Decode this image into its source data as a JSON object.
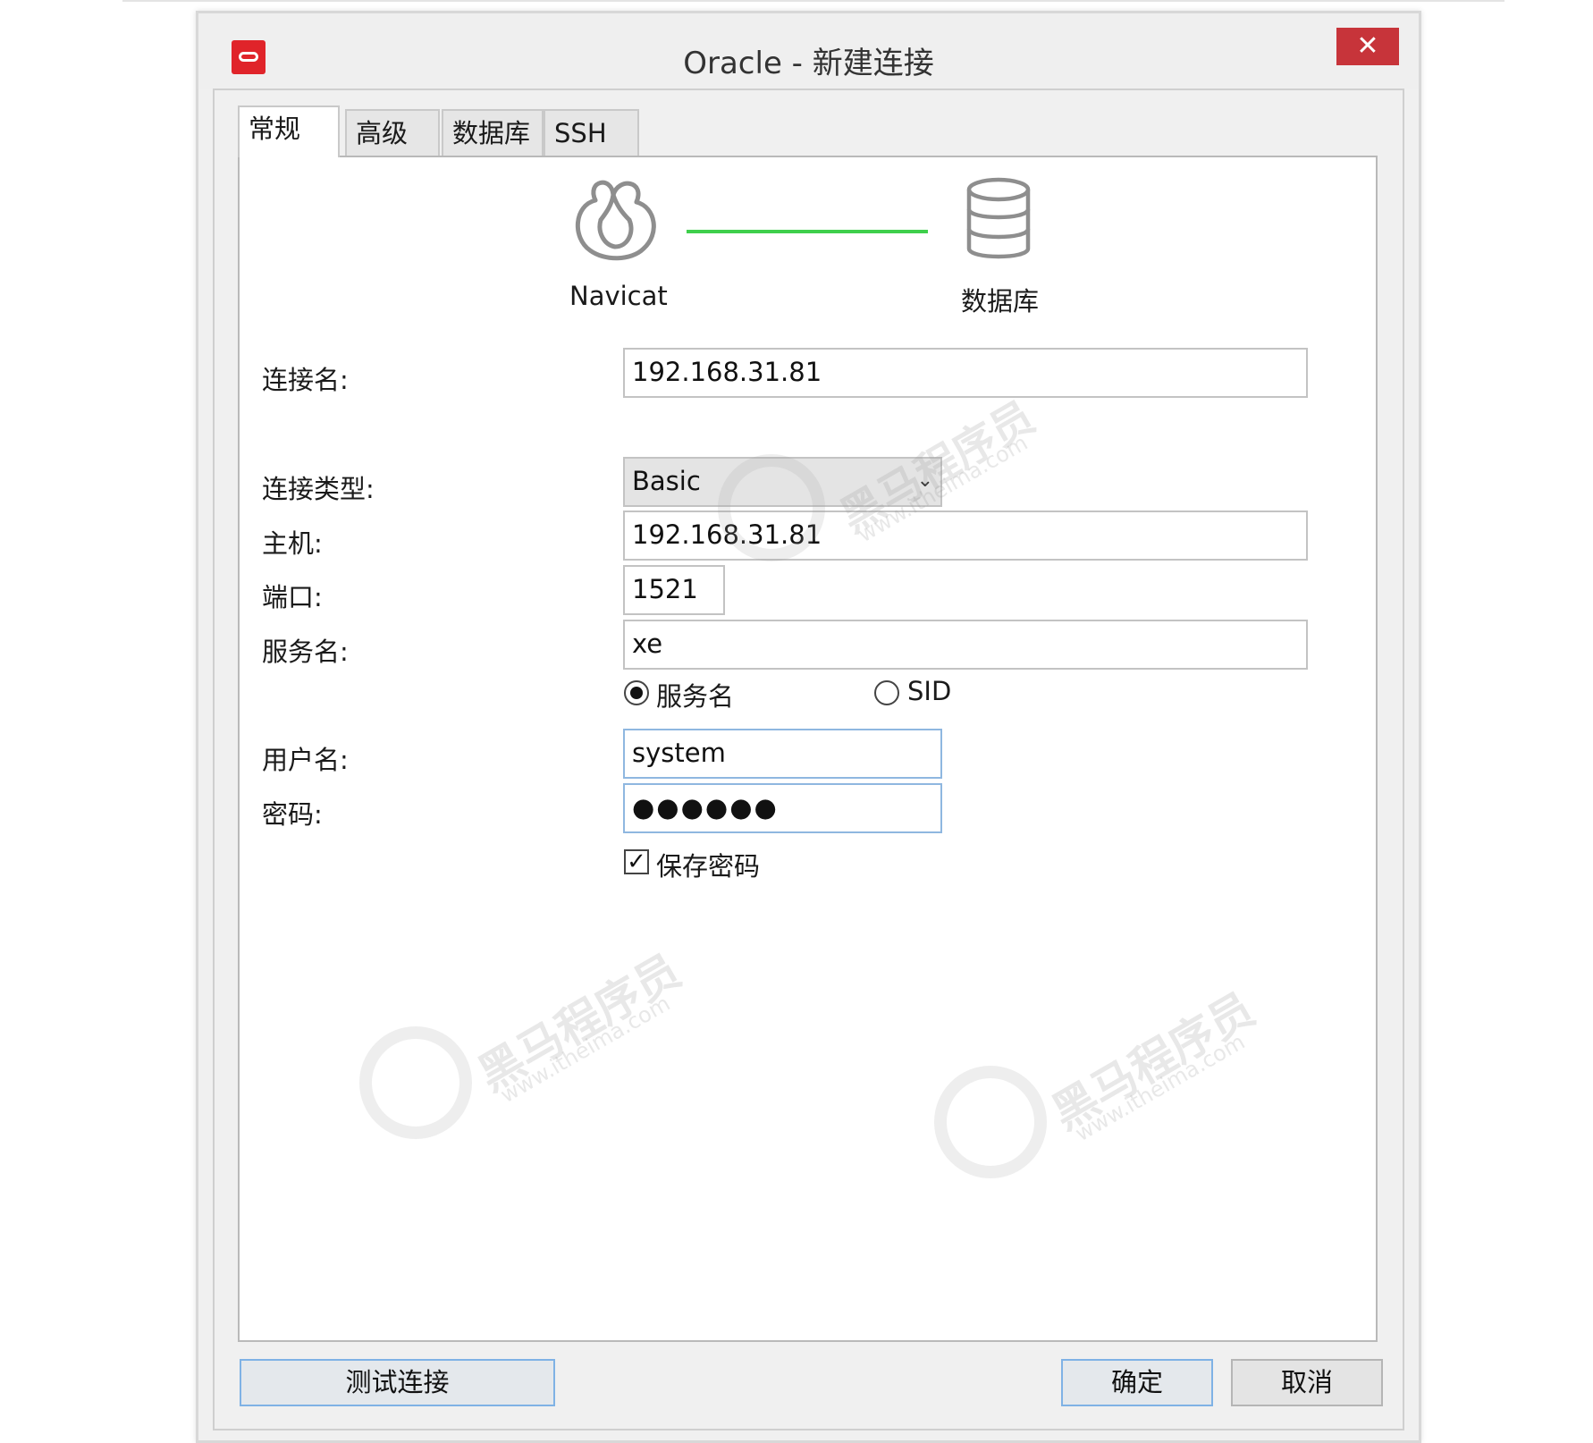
{
  "window": {
    "title": "Oracle - 新建连接",
    "close_glyph": "✕",
    "app_icon": "oracle-icon"
  },
  "tabs": [
    {
      "label": "常规",
      "active": true
    },
    {
      "label": "高级",
      "active": false
    },
    {
      "label": "数据库",
      "active": false
    },
    {
      "label": "SSH",
      "active": false
    }
  ],
  "diagram": {
    "left_label": "Navicat",
    "right_label": "数据库",
    "line_color": "#3fcf4c"
  },
  "form": {
    "connection_name_label": "连接名:",
    "connection_name_value": "192.168.31.81",
    "connection_type_label": "连接类型:",
    "connection_type_value": "Basic",
    "host_label": "主机:",
    "host_value": "192.168.31.81",
    "port_label": "端口:",
    "port_value": "1521",
    "service_name_label": "服务名:",
    "service_name_value": "xe",
    "radio_service_name": "服务名",
    "radio_sid": "SID",
    "username_label": "用户名:",
    "username_value": "system",
    "password_label": "密码:",
    "password_value": "●●●●●●",
    "save_password_label": "保存密码",
    "save_password_checked": "✓"
  },
  "buttons": {
    "test": "测试连接",
    "ok": "确定",
    "cancel": "取消"
  },
  "watermark": {
    "brand": "黑马程序员",
    "site": "www.itheima.com"
  }
}
